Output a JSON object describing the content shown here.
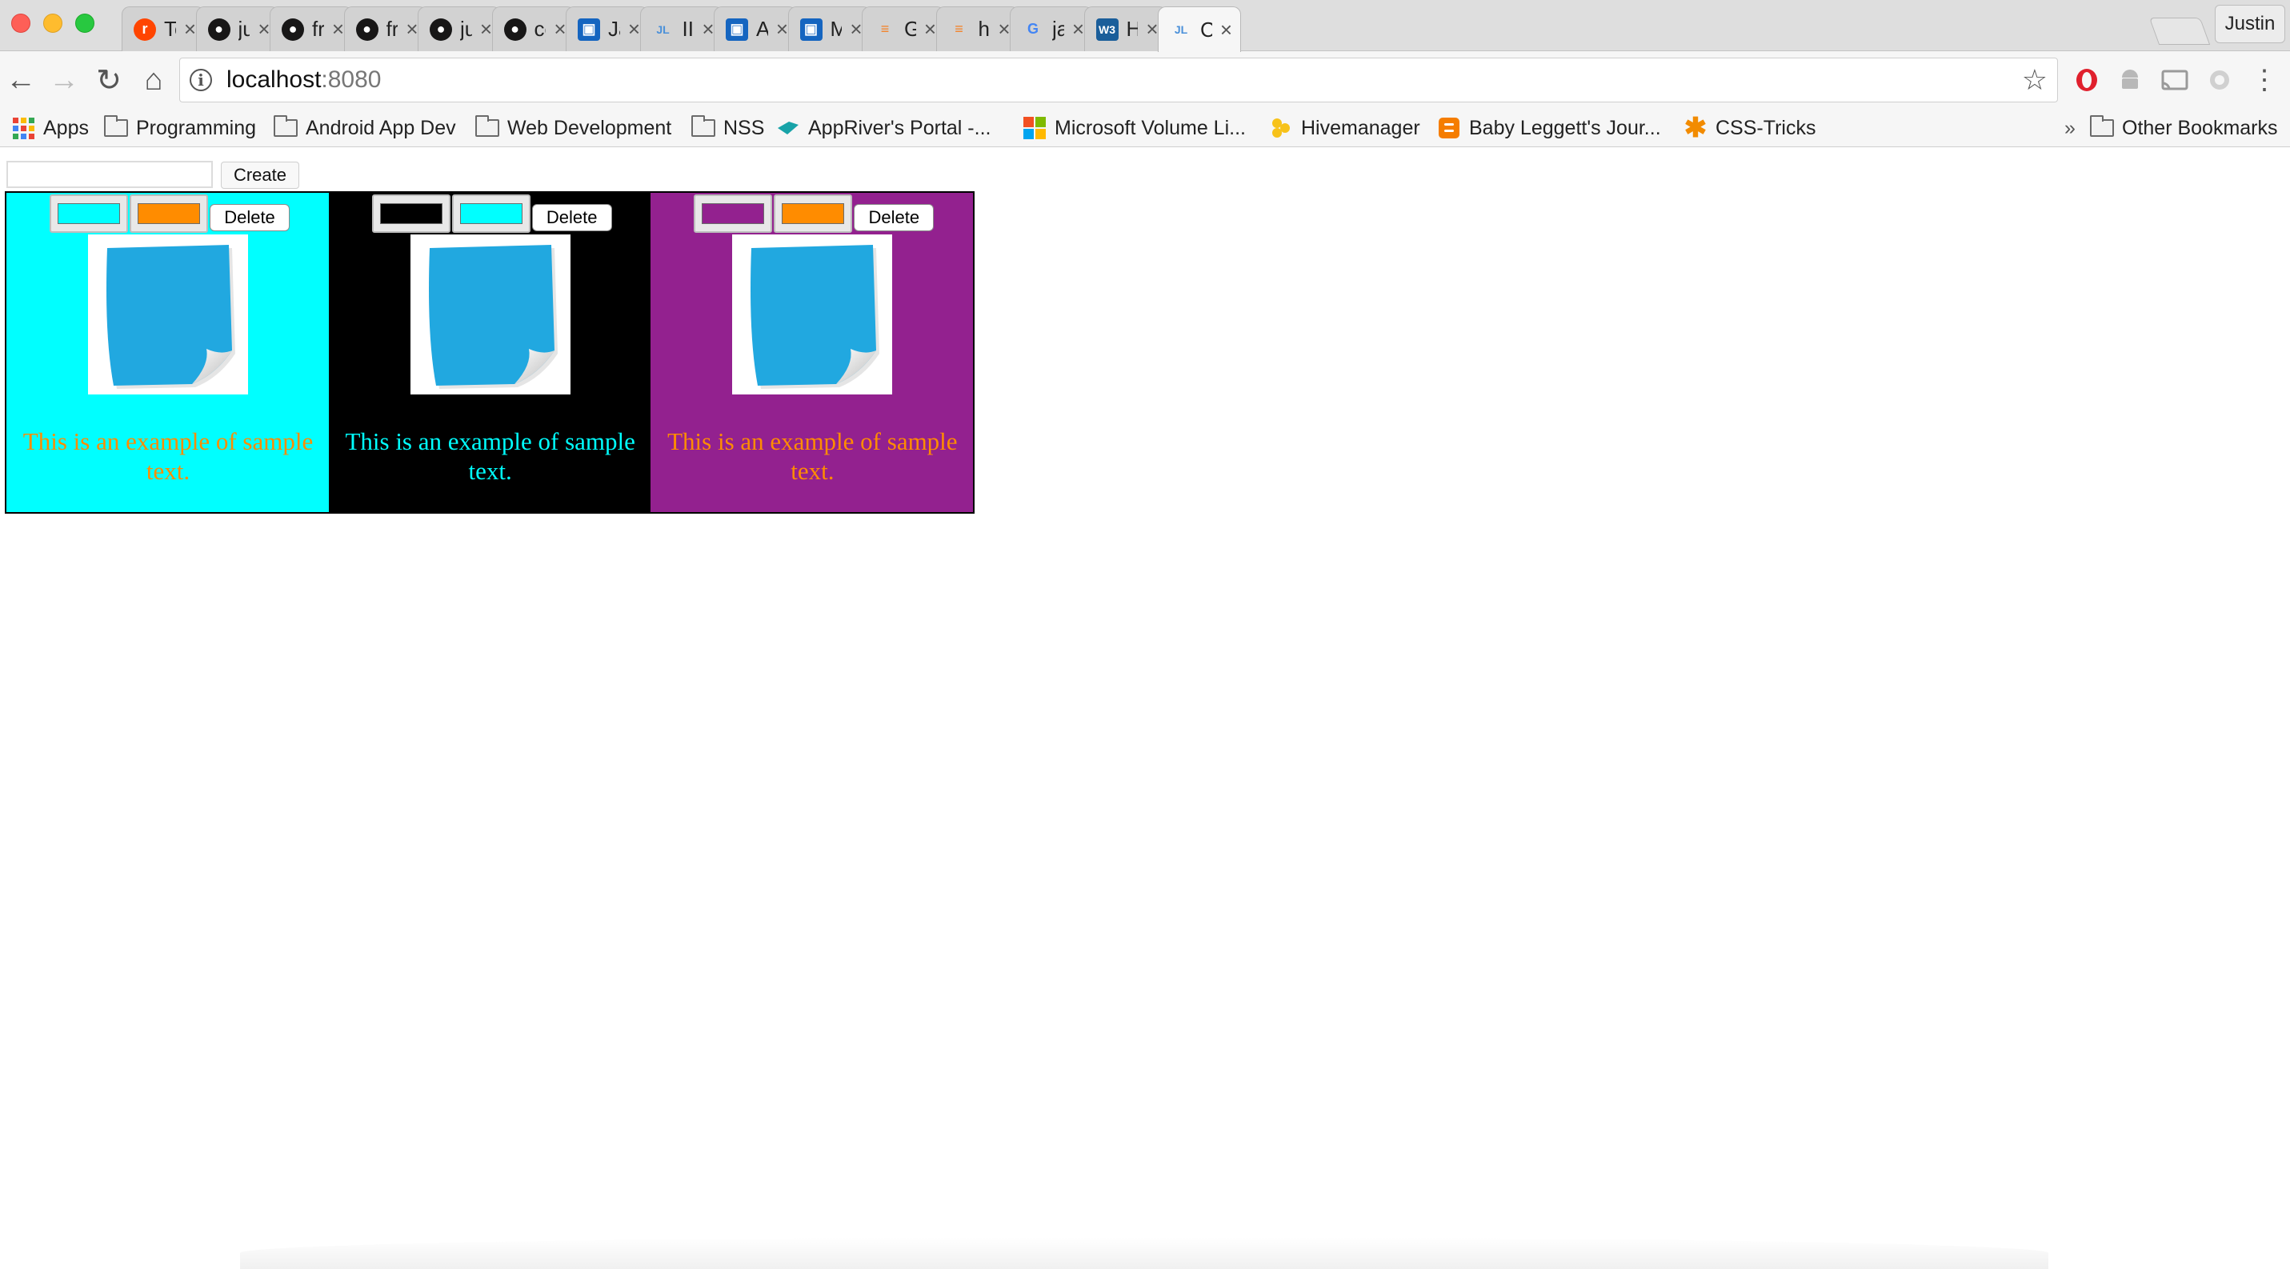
{
  "browser": {
    "tabs": [
      {
        "title": "Techn",
        "icon": "reddit-icon",
        "icon_color": "#ff4500",
        "icon_glyph": "r"
      },
      {
        "title": "justin",
        "icon": "github-icon",
        "icon_color": "#181717",
        "icon_glyph": "●"
      },
      {
        "title": "front-",
        "icon": "github-icon",
        "icon_color": "#181717",
        "icon_glyph": "●"
      },
      {
        "title": "front-",
        "icon": "github-icon",
        "icon_color": "#181717",
        "icon_glyph": "●"
      },
      {
        "title": "justin",
        "icon": "github-icon",
        "icon_color": "#181717",
        "icon_glyph": "●"
      },
      {
        "title": "comp",
        "icon": "github-icon",
        "icon_color": "#181717",
        "icon_glyph": "●"
      },
      {
        "title": "JavaS",
        "icon": "mdn-book-icon",
        "icon_color": "#1565c0",
        "icon_glyph": "▣"
      },
      {
        "title": "IIFE",
        "icon": "jl-icon",
        "icon_color": "#4a90d9",
        "icon_glyph": "JL"
      },
      {
        "title": "Array",
        "icon": "mdn-book-icon",
        "icon_color": "#1565c0",
        "icon_glyph": "▣"
      },
      {
        "title": "Math.",
        "icon": "mdn-book-icon",
        "icon_color": "#1565c0",
        "icon_glyph": "▣"
      },
      {
        "title": "Gene",
        "icon": "stackoverflow-icon",
        "icon_color": "#f48024",
        "icon_glyph": "≡"
      },
      {
        "title": "html -",
        "icon": "stackoverflow-icon",
        "icon_color": "#f48024",
        "icon_glyph": "≡"
      },
      {
        "title": "javas",
        "icon": "google-icon",
        "icon_color": "#4285f4",
        "icon_glyph": "G"
      },
      {
        "title": "How t",
        "icon": "w3schools-icon",
        "icon_color": "#1a5e9a",
        "icon_glyph": "W3"
      },
      {
        "title": "Cards",
        "icon": "jl-icon",
        "icon_color": "#4a90d9",
        "icon_glyph": "JL",
        "active": true
      }
    ],
    "tab_close_glyph": "×",
    "profile_name": "Justin",
    "address": {
      "host": "localhost",
      "port": ":8080"
    },
    "nav": {
      "back": "←",
      "forward": "→",
      "reload": "↻",
      "home": "⌂",
      "star": "☆",
      "menu": "⋮"
    }
  },
  "bookmarks": {
    "items": [
      {
        "label": "Apps",
        "icon": "apps-grid-icon"
      },
      {
        "label": "Programming",
        "icon": "folder-icon"
      },
      {
        "label": "Android App Dev",
        "icon": "folder-icon"
      },
      {
        "label": "Web Development",
        "icon": "folder-icon"
      },
      {
        "label": "NSS",
        "icon": "folder-icon"
      },
      {
        "label": "AppRiver's Portal -...",
        "icon": "appriver-icon"
      },
      {
        "label": "Microsoft Volume Li...",
        "icon": "microsoft-icon"
      },
      {
        "label": "Hivemanager",
        "icon": "hivemanager-icon"
      },
      {
        "label": "Baby Leggett's Jour...",
        "icon": "blogger-icon"
      },
      {
        "label": "CSS-Tricks",
        "icon": "css-tricks-icon"
      }
    ],
    "overflow_glyph": "»",
    "other_label": "Other Bookmarks"
  },
  "page": {
    "create_input_value": "",
    "create_label": "Create",
    "cards": [
      {
        "background": "#00ffff",
        "swatch_colors": [
          "#00ffff",
          "#ff8c00"
        ],
        "text_color": "#ff8c00",
        "delete_label": "Delete",
        "text": "This is an example of sample text."
      },
      {
        "background": "#000000",
        "swatch_colors": [
          "#000000",
          "#00ffff"
        ],
        "text_color": "#00ffff",
        "delete_label": "Delete",
        "text": "This is an example of sample text."
      },
      {
        "background": "#93218f",
        "swatch_colors": [
          "#93218f",
          "#ff8c00"
        ],
        "text_color": "#ff8c00",
        "delete_label": "Delete",
        "text": "This is an example of sample text."
      }
    ],
    "sticky_note_color": "#21a8e0"
  }
}
